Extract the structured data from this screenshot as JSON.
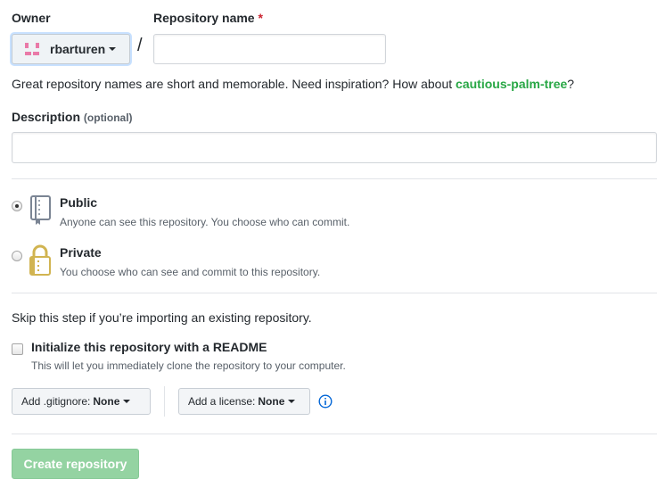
{
  "owner": {
    "label": "Owner",
    "selected": "rbarturen"
  },
  "repo_name": {
    "label": "Repository name",
    "required_mark": "*",
    "separator": "/",
    "value": "",
    "placeholder": ""
  },
  "hint": {
    "prefix": "Great repository names are short and memorable. Need inspiration? How about ",
    "suggestion": "cautious-palm-tree",
    "suffix": "?"
  },
  "description": {
    "label": "Description",
    "optional": "(optional)",
    "value": ""
  },
  "visibility": {
    "selected": "public",
    "options": [
      {
        "id": "public",
        "title": "Public",
        "note": "Anyone can see this repository. You choose who can commit.",
        "icon": "repo-book-icon"
      },
      {
        "id": "private",
        "title": "Private",
        "note": "You choose who can see and commit to this repository.",
        "icon": "lock-icon"
      }
    ]
  },
  "init": {
    "skip_text": "Skip this step if you’re importing an existing repository.",
    "readme_label": "Initialize this repository with a README",
    "readme_note": "This will let you immediately clone the repository to your computer.",
    "readme_checked": false
  },
  "gitignore": {
    "label": "Add .gitignore:",
    "value": "None"
  },
  "license": {
    "label": "Add a license:",
    "value": "None"
  },
  "info_icon": "info-icon",
  "submit": {
    "label": "Create repository"
  },
  "colors": {
    "accent_green": "#28a745",
    "required_red": "#cb2431",
    "button_disabled_green": "#94d3a2",
    "info_blue": "#0366d6"
  }
}
